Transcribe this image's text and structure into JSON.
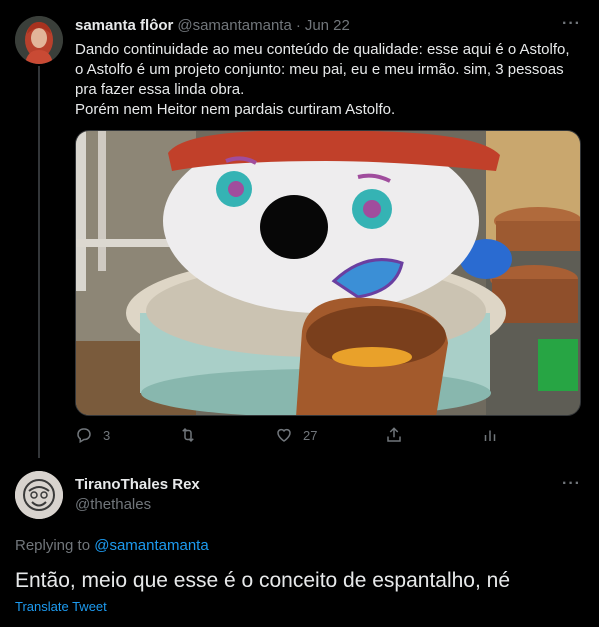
{
  "tweet": {
    "display_name": "samanta flôor",
    "handle": "@samantamanta",
    "separator": "·",
    "date": "Jun 22",
    "lines": [
      "Dando continuidade ao meu conteúdo de qualidade: esse aqui é o Astolfo,",
      "o Astolfo é um projeto conjunto: meu pai, eu e meu irmão. sim, 3 pessoas",
      "pra fazer essa linda obra.",
      "Porém nem Heitor nem pardais curtiram Astolfo."
    ],
    "more_label": "···",
    "actions": {
      "reply": {
        "icon": "reply-icon",
        "count": "3"
      },
      "retweet": {
        "icon": "retweet-icon",
        "count": ""
      },
      "like": {
        "icon": "heart-icon",
        "count": "27"
      },
      "share": {
        "icon": "share-icon"
      },
      "analytics": {
        "icon": "analytics-icon"
      }
    }
  },
  "reply": {
    "display_name": "TiranoThales Rex",
    "handle": "@thethales",
    "more_label": "···",
    "replying_prefix": "Replying to",
    "replying_to": "@samantamanta",
    "text": "Então, meio que esse é o conceito de espantalho, né",
    "translate_label": "Translate Tweet"
  },
  "colors": {
    "background": "#000000",
    "text": "#e7e9ea",
    "muted": "#71767b",
    "link": "#1d9bf0",
    "divider": "#333639"
  }
}
